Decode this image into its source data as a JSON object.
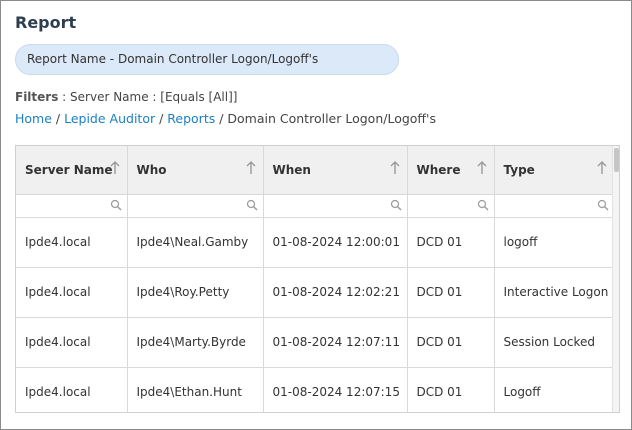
{
  "page": {
    "title": "Report"
  },
  "report": {
    "name": "Report Name - Domain Controller Logon/Logoff's"
  },
  "filters": {
    "label": "Filters",
    "text": " : Server Name : [Equals [All]]"
  },
  "breadcrumb": {
    "items": [
      "Home",
      "Lepide Auditor",
      "Reports"
    ],
    "separator": " / ",
    "current": "Domain Controller Logon/Logoff's"
  },
  "table": {
    "columns": [
      "Server Name",
      "Who",
      "When",
      "Where",
      "Type"
    ],
    "rows": [
      [
        "Ipde4.local",
        "Ipde4\\Neal.Gamby",
        "01-08-2024 12:00:01",
        "DCD 01",
        "logoff"
      ],
      [
        "Ipde4.local",
        "Ipde4\\Roy.Petty",
        "01-08-2024 12:02:21",
        "DCD 01",
        "Interactive Logon"
      ],
      [
        "Ipde4.local",
        "Ipde4\\Marty.Byrde",
        "01-08-2024 12:07:11",
        "DCD 01",
        "Session Locked"
      ],
      [
        "Ipde4.local",
        "Ipde4\\Ethan.Hunt",
        "01-08-2024 12:07:15",
        "DCD 01",
        "Logoff"
      ]
    ]
  },
  "icons": {
    "sort": "arrow-up-icon",
    "filter": "search-icon"
  },
  "colors": {
    "accent_link": "#1a7fc4",
    "report_pill_bg": "#dce9f9",
    "title": "#2d3e50",
    "header_bg": "#f0f0f0"
  }
}
